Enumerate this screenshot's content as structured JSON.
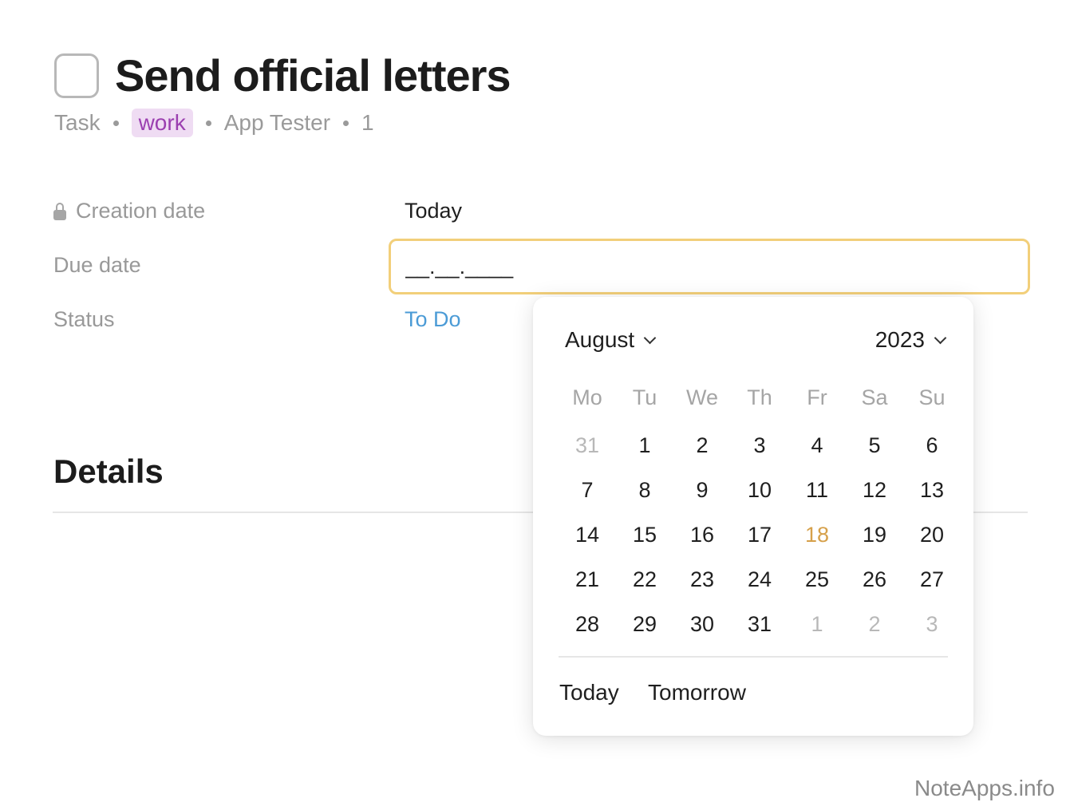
{
  "task": {
    "title": "Send official letters",
    "type": "Task",
    "tag": "work",
    "owner": "App Tester",
    "count": "1"
  },
  "properties": {
    "creation_label": "Creation date",
    "creation_value": "Today",
    "due_label": "Due date",
    "due_value": "__.__.____",
    "status_label": "Status",
    "status_value": "To Do"
  },
  "details": {
    "heading": "Details"
  },
  "calendar": {
    "month": "August",
    "year": "2023",
    "weekdays": [
      "Mo",
      "Tu",
      "We",
      "Th",
      "Fr",
      "Sa",
      "Su"
    ],
    "weeks": [
      [
        {
          "d": "31",
          "muted": true
        },
        {
          "d": "1"
        },
        {
          "d": "2"
        },
        {
          "d": "3"
        },
        {
          "d": "4"
        },
        {
          "d": "5"
        },
        {
          "d": "6"
        }
      ],
      [
        {
          "d": "7"
        },
        {
          "d": "8"
        },
        {
          "d": "9"
        },
        {
          "d": "10"
        },
        {
          "d": "11"
        },
        {
          "d": "12"
        },
        {
          "d": "13"
        }
      ],
      [
        {
          "d": "14"
        },
        {
          "d": "15"
        },
        {
          "d": "16"
        },
        {
          "d": "17"
        },
        {
          "d": "18",
          "today": true
        },
        {
          "d": "19"
        },
        {
          "d": "20"
        }
      ],
      [
        {
          "d": "21"
        },
        {
          "d": "22"
        },
        {
          "d": "23"
        },
        {
          "d": "24"
        },
        {
          "d": "25"
        },
        {
          "d": "26"
        },
        {
          "d": "27"
        }
      ],
      [
        {
          "d": "28"
        },
        {
          "d": "29"
        },
        {
          "d": "30"
        },
        {
          "d": "31"
        },
        {
          "d": "1",
          "muted": true
        },
        {
          "d": "2",
          "muted": true
        },
        {
          "d": "3",
          "muted": true
        }
      ]
    ],
    "quick_today": "Today",
    "quick_tomorrow": "Tomorrow"
  },
  "colors": {
    "accent_today": "#d6a04a",
    "status_blue": "#4b9bd6",
    "tag_bg": "#efdcf3",
    "tag_fg": "#9b3fb0",
    "input_focus": "#f2cf7a"
  },
  "watermark": "NoteApps.info"
}
